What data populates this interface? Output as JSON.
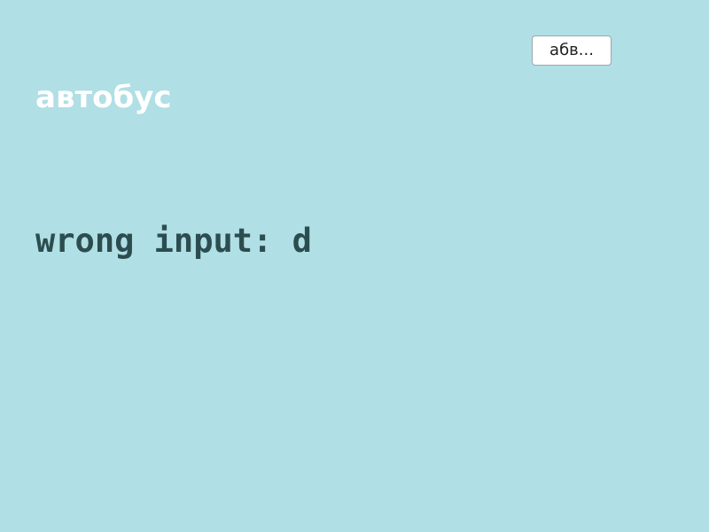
{
  "game": {
    "alphabet_button_label": "абв...",
    "target_word": "автобус",
    "feedback_text": "wrong input: d"
  },
  "colors": {
    "background": "#b0dfe5",
    "target_word": "#ffffff",
    "feedback": "#2c4d4f",
    "button_background": "#ffffff"
  }
}
